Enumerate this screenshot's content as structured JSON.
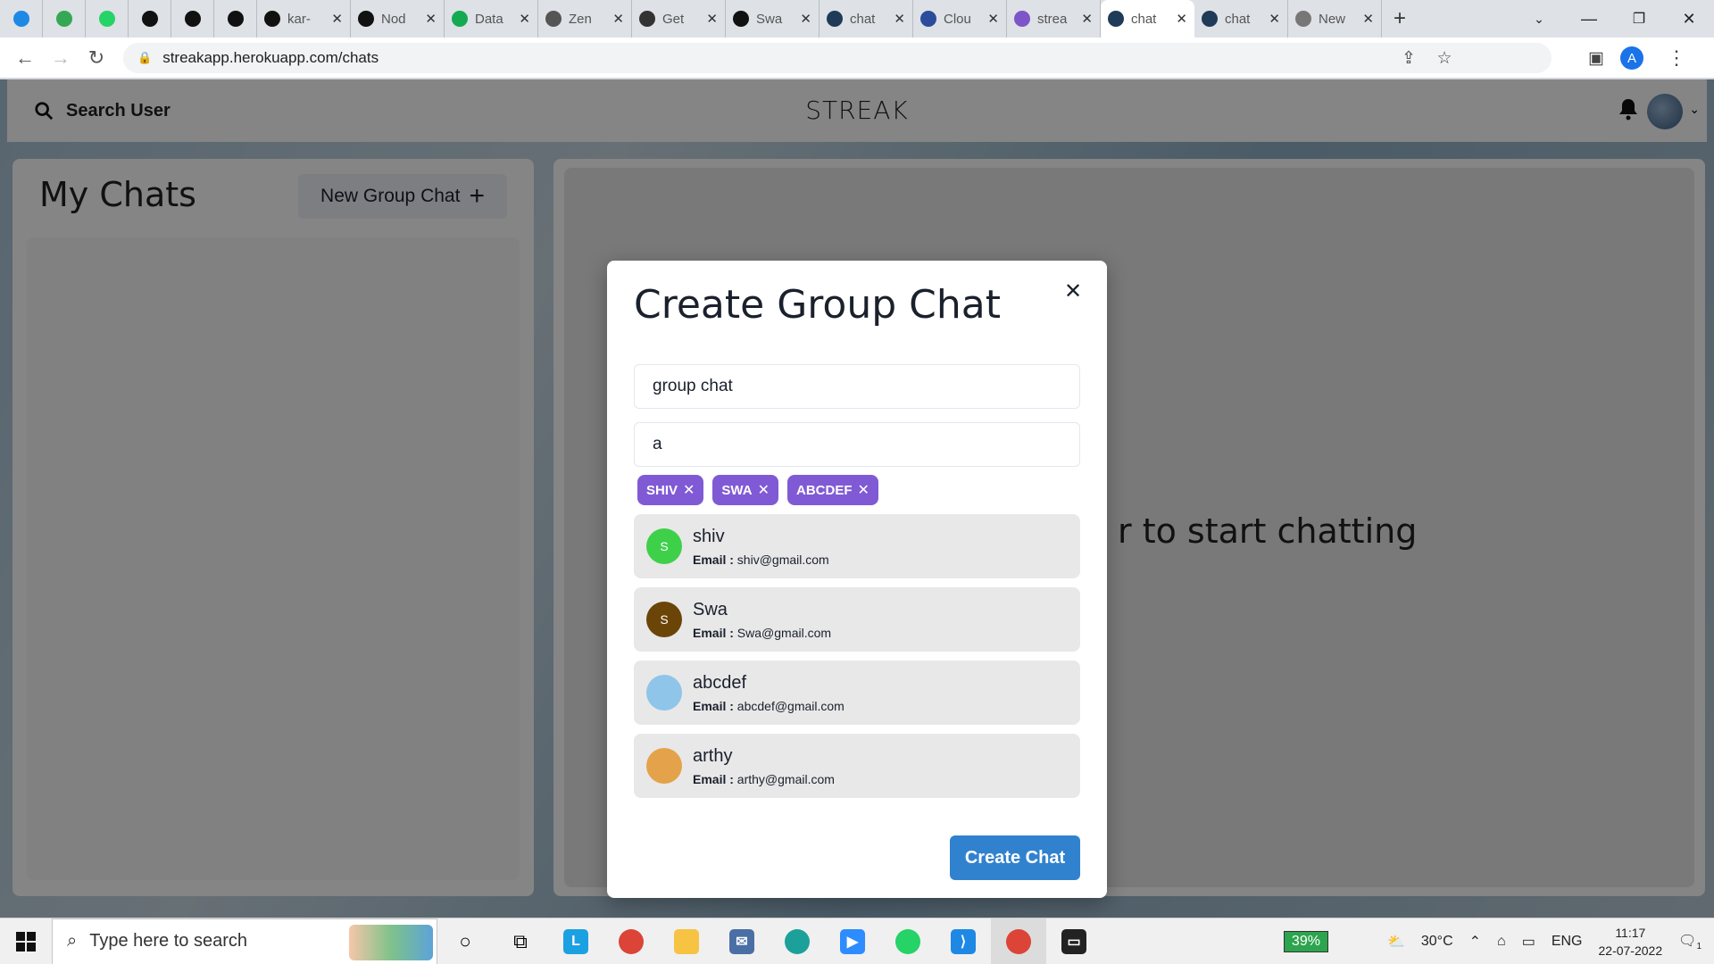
{
  "browser": {
    "pinned_tabs": [
      {
        "icon": "circle-app-icon",
        "color": "#1e88e5"
      },
      {
        "icon": "badge-app-icon",
        "color": "#34a853"
      },
      {
        "icon": "whatsapp-icon",
        "color": "#25d366"
      },
      {
        "icon": "github-icon",
        "color": "#111111"
      },
      {
        "icon": "github-icon",
        "color": "#111111"
      },
      {
        "icon": "github-icon",
        "color": "#111111"
      }
    ],
    "tabs": [
      {
        "title": "kar-",
        "icon": "github-icon",
        "color": "#111111"
      },
      {
        "title": "Nod",
        "icon": "github-icon",
        "color": "#111111"
      },
      {
        "title": "Data",
        "icon": "mongodb-icon",
        "color": "#13aa52"
      },
      {
        "title": "Zen",
        "icon": "doc-icon",
        "color": "#555555"
      },
      {
        "title": "Get",
        "icon": "compass-icon",
        "color": "#333333"
      },
      {
        "title": "Swa",
        "icon": "github-icon",
        "color": "#111111"
      },
      {
        "title": "chat",
        "icon": "react-icon",
        "color": "#1f3b57"
      },
      {
        "title": "Clou",
        "icon": "cloud-icon",
        "color": "#2b4c9b"
      },
      {
        "title": "strea",
        "icon": "heroku-icon",
        "color": "#7d55c7"
      },
      {
        "title": "chat",
        "icon": "react-icon",
        "color": "#1f3b57",
        "active": true
      },
      {
        "title": "chat",
        "icon": "react-icon",
        "color": "#1f3b57"
      },
      {
        "title": "New",
        "icon": "globe-icon",
        "color": "#777777"
      }
    ],
    "url": "streakapp.herokuapp.com/chats",
    "profile_initial": "A"
  },
  "app": {
    "search_label": "Search User",
    "title": "STREAK",
    "my_chats_title": "My Chats",
    "new_group_label": "New Group Chat",
    "chat_placeholder": "r to start chatting"
  },
  "modal": {
    "title": "Create Group Chat",
    "chat_name_value": "group chat",
    "search_value": "a",
    "selected_users": [
      "SHIV",
      "SWA",
      "ABCDEF"
    ],
    "email_label": "Email :",
    "users": [
      {
        "name": "shiv",
        "email": "shiv@gmail.com",
        "initial": "S",
        "avatar_color": "#3fd04a"
      },
      {
        "name": "Swa",
        "email": "Swa@gmail.com",
        "initial": "S",
        "avatar_color": "#6b4407"
      },
      {
        "name": "abcdef",
        "email": "abcdef@gmail.com",
        "initial": "",
        "avatar_color": "#8ec5e8"
      },
      {
        "name": "arthy",
        "email": "arthy@gmail.com",
        "initial": "",
        "avatar_color": "#e4a34a"
      }
    ],
    "create_label": "Create Chat"
  },
  "taskbar": {
    "search_placeholder": "Type here to search",
    "battery": "39%",
    "temperature": "30°C",
    "language": "ENG",
    "time": "11:17",
    "date": "22-07-2022",
    "notification_count": "1"
  }
}
